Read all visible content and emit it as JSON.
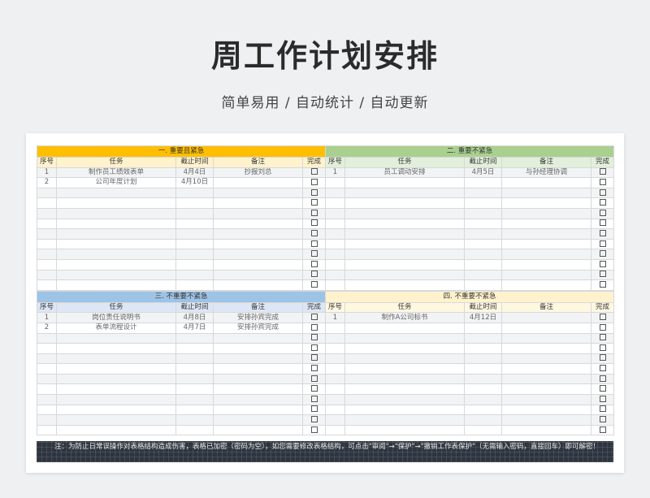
{
  "page": {
    "title": "周工作计划安排",
    "subtitle": "简单易用  /  自动统计  /  自动更新"
  },
  "colors": {
    "q1": "#ffbf00",
    "q2": "#a9d08e",
    "q3": "#9dc3e6",
    "q4": "#fff2cc",
    "q1_head": "#fff2cc",
    "q2_head": "#e2efda",
    "q3_head": "#dde6f5",
    "q4_head": "#fff8e1"
  },
  "columns": [
    "序号",
    "任务",
    "截止时间",
    "备注",
    "完成"
  ],
  "quadrants": [
    {
      "title": "一. 重要且紧急",
      "rows": [
        [
          "1",
          "制作员工绩效表单",
          "4月4日",
          "抄报刘总"
        ],
        [
          "2",
          "公司年度计划",
          "4月10日",
          ""
        ],
        [
          "",
          "",
          "",
          ""
        ],
        [
          "",
          "",
          "",
          ""
        ],
        [
          "",
          "",
          "",
          ""
        ],
        [
          "",
          "",
          "",
          ""
        ],
        [
          "",
          "",
          "",
          ""
        ],
        [
          "",
          "",
          "",
          ""
        ],
        [
          "",
          "",
          "",
          ""
        ],
        [
          "",
          "",
          "",
          ""
        ],
        [
          "",
          "",
          "",
          ""
        ],
        [
          "",
          "",
          "",
          ""
        ]
      ]
    },
    {
      "title": "二. 重要不紧急",
      "rows": [
        [
          "1",
          "员工调动安排",
          "4月5日",
          "与孙经理协调"
        ],
        [
          "",
          "",
          "",
          ""
        ],
        [
          "",
          "",
          "",
          ""
        ],
        [
          "",
          "",
          "",
          ""
        ],
        [
          "",
          "",
          "",
          ""
        ],
        [
          "",
          "",
          "",
          ""
        ],
        [
          "",
          "",
          "",
          ""
        ],
        [
          "",
          "",
          "",
          ""
        ],
        [
          "",
          "",
          "",
          ""
        ],
        [
          "",
          "",
          "",
          ""
        ],
        [
          "",
          "",
          "",
          ""
        ],
        [
          "",
          "",
          "",
          ""
        ]
      ]
    },
    {
      "title": "三. 不重要不紧急",
      "rows": [
        [
          "1",
          "岗位责任说明书",
          "4月8日",
          "安排孙宾完成"
        ],
        [
          "2",
          "表单流程设计",
          "4月7日",
          "安排孙宾完成"
        ],
        [
          "",
          "",
          "",
          ""
        ],
        [
          "",
          "",
          "",
          ""
        ],
        [
          "",
          "",
          "",
          ""
        ],
        [
          "",
          "",
          "",
          ""
        ],
        [
          "",
          "",
          "",
          ""
        ],
        [
          "",
          "",
          "",
          ""
        ],
        [
          "",
          "",
          "",
          ""
        ],
        [
          "",
          "",
          "",
          ""
        ],
        [
          "",
          "",
          "",
          ""
        ],
        [
          "",
          "",
          "",
          ""
        ]
      ]
    },
    {
      "title": "四. 不重要不紧急",
      "rows": [
        [
          "1",
          "制作A公司标书",
          "4月12日",
          ""
        ],
        [
          "",
          "",
          "",
          ""
        ],
        [
          "",
          "",
          "",
          ""
        ],
        [
          "",
          "",
          "",
          ""
        ],
        [
          "",
          "",
          "",
          ""
        ],
        [
          "",
          "",
          "",
          ""
        ],
        [
          "",
          "",
          "",
          ""
        ],
        [
          "",
          "",
          "",
          ""
        ],
        [
          "",
          "",
          "",
          ""
        ],
        [
          "",
          "",
          "",
          ""
        ],
        [
          "",
          "",
          "",
          ""
        ],
        [
          "",
          "",
          "",
          ""
        ]
      ]
    }
  ],
  "note": "注：为防止日常误操作对表格结构造成伤害，表格已加密（密码为空），如您需要修改表格结构，可点击\"审阅\"→\"保护\"→\"撤销工作表保护\"（无需输入密码，直接回车）即可解密！"
}
